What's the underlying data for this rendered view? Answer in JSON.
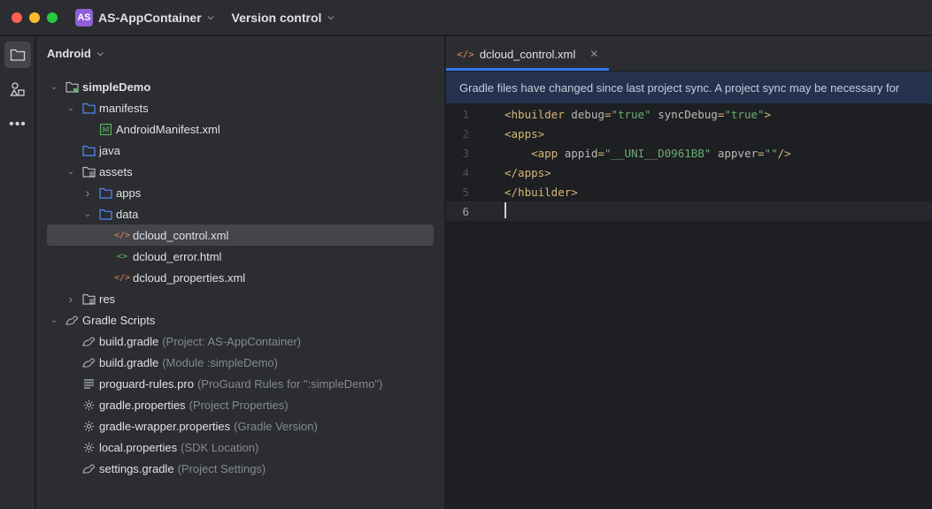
{
  "titlebar": {
    "project_badge": "AS",
    "project_name": "AS-AppContainer",
    "vcs_label": "Version control"
  },
  "toolstrip": {
    "icons": [
      "folder-icon",
      "shapes-icon",
      "more-icon"
    ]
  },
  "project_panel": {
    "view_label": "Android",
    "tree": [
      {
        "label": "simpleDemo",
        "hint": "",
        "icon": "module-folder-icon",
        "expanded": true,
        "depth": 0
      },
      {
        "label": "manifests",
        "hint": "",
        "icon": "folder-icon",
        "expanded": true,
        "depth": 1
      },
      {
        "label": "AndroidManifest.xml",
        "hint": "",
        "icon": "manifest-icon",
        "depth": 2
      },
      {
        "label": "java",
        "hint": "",
        "icon": "folder-icon",
        "depth": 1
      },
      {
        "label": "assets",
        "hint": "",
        "icon": "assets-folder-icon",
        "expanded": true,
        "depth": 1
      },
      {
        "label": "apps",
        "hint": "",
        "icon": "folder-icon",
        "expanded": false,
        "depth": 2
      },
      {
        "label": "data",
        "hint": "",
        "icon": "folder-icon",
        "expanded": true,
        "depth": 2
      },
      {
        "label": "dcloud_control.xml",
        "hint": "",
        "icon": "xml-icon",
        "depth": 3,
        "selected": true
      },
      {
        "label": "dcloud_error.html",
        "hint": "",
        "icon": "html-icon",
        "depth": 3
      },
      {
        "label": "dcloud_properties.xml",
        "hint": "",
        "icon": "xml-icon",
        "depth": 3
      },
      {
        "label": "res",
        "hint": "",
        "icon": "res-folder-icon",
        "expanded": false,
        "depth": 1
      },
      {
        "label": "Gradle Scripts",
        "hint": "",
        "icon": "gradle-icon",
        "expanded": true,
        "depth": 0
      },
      {
        "label": "build.gradle",
        "hint": "(Project: AS-AppContainer)",
        "icon": "gradle-icon",
        "depth": 1
      },
      {
        "label": "build.gradle",
        "hint": "(Module :simpleDemo)",
        "icon": "gradle-icon",
        "depth": 1
      },
      {
        "label": "proguard-rules.pro",
        "hint": "(ProGuard Rules for \":simpleDemo\")",
        "icon": "text-file-icon",
        "depth": 1
      },
      {
        "label": "gradle.properties",
        "hint": "(Project Properties)",
        "icon": "settings-gear-icon",
        "depth": 1
      },
      {
        "label": "gradle-wrapper.properties",
        "hint": "(Gradle Version)",
        "icon": "settings-gear-icon",
        "depth": 1
      },
      {
        "label": "local.properties",
        "hint": "(SDK Location)",
        "icon": "settings-gear-icon",
        "depth": 1
      },
      {
        "label": "settings.gradle",
        "hint": "(Project Settings)",
        "icon": "gradle-icon",
        "depth": 1
      }
    ]
  },
  "editor": {
    "tab_label": "dcloud_control.xml",
    "banner": "Gradle files have changed since last project sync. A project sync may be necessary for",
    "lines": [
      {
        "num": "1",
        "parts": [
          [
            "tag",
            "<hbuilder"
          ],
          [
            "attr",
            " debug"
          ],
          [
            "tag",
            "="
          ],
          [
            "val",
            "\"true\""
          ],
          [
            "attr",
            " syncDebug"
          ],
          [
            "tag",
            "="
          ],
          [
            "val",
            "\"true\""
          ],
          [
            "tag",
            ">"
          ]
        ]
      },
      {
        "num": "2",
        "parts": [
          [
            "tag",
            "<apps>"
          ]
        ]
      },
      {
        "num": "3",
        "parts": [
          [
            "attr",
            "    "
          ],
          [
            "tag",
            "<app"
          ],
          [
            "attr",
            " appid"
          ],
          [
            "tag",
            "="
          ],
          [
            "val",
            "\"__UNI__D0961BB\""
          ],
          [
            "attr",
            " appver"
          ],
          [
            "tag",
            "="
          ],
          [
            "val",
            "\"\""
          ],
          [
            "tag",
            "/>"
          ]
        ]
      },
      {
        "num": "4",
        "parts": [
          [
            "tag",
            "</apps>"
          ]
        ]
      },
      {
        "num": "5",
        "parts": [
          [
            "tag",
            "</hbuilder>"
          ]
        ]
      },
      {
        "num": "6",
        "parts": [],
        "current": true
      }
    ]
  }
}
